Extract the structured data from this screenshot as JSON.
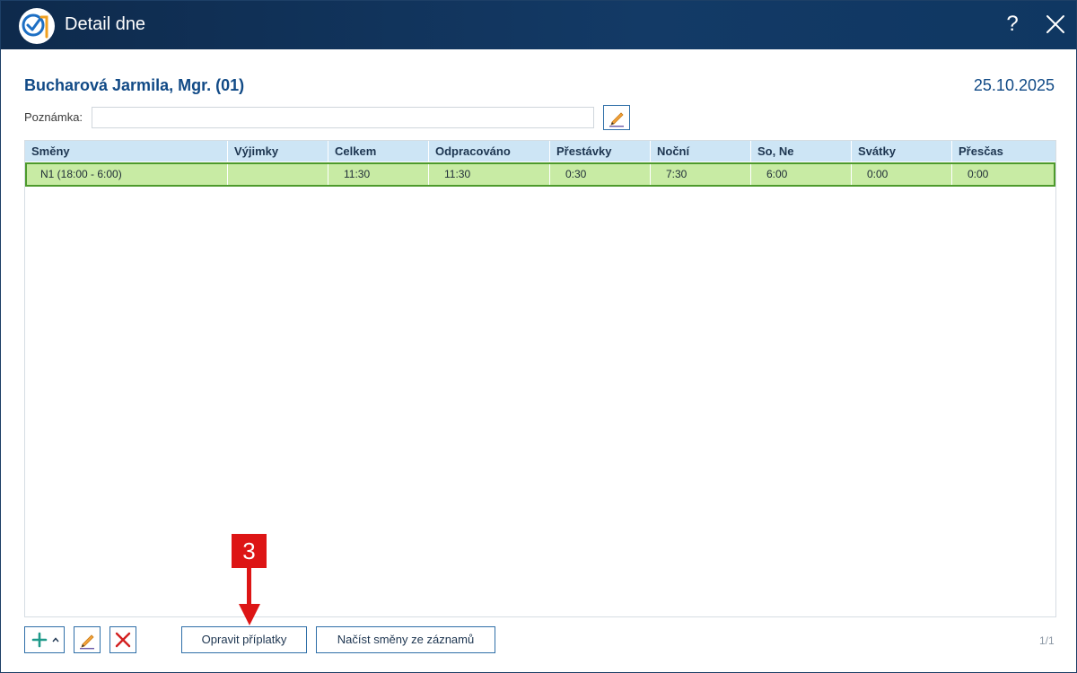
{
  "window": {
    "title": "Detail dne",
    "help": "?"
  },
  "employee": {
    "name": "Bucharová Jarmila, Mgr. (01)",
    "date": "25.10.2025"
  },
  "note": {
    "label": "Poznámka:",
    "value": ""
  },
  "table": {
    "columns": [
      "Směny",
      "Výjimky",
      "Celkem",
      "Odpracováno",
      "Přestávky",
      "Noční",
      "So, Ne",
      "Svátky",
      "Přesčas"
    ],
    "rows": [
      {
        "shift": "N1 (18:00 - 6:00)",
        "exceptions": "",
        "total": "11:30",
        "worked": "11:30",
        "breaks": "0:30",
        "night": "7:30",
        "weekend": "6:00",
        "holidays": "0:00",
        "overtime": "0:00"
      }
    ]
  },
  "toolbar": {
    "fix_surcharges": "Opravit příplatky",
    "load_shifts": "Načíst směny ze záznamů",
    "pager": "1/1"
  },
  "annotation": {
    "badge": "3"
  },
  "colors": {
    "titlebar": "#123560",
    "header_bg": "#cde5f5",
    "selected_row_bg": "#c8eba4",
    "selected_row_border": "#4d9a2c",
    "accent_blue": "#114a86",
    "delete_red": "#d21f1f",
    "add_green": "#1f9a8a",
    "callout_red": "#dd1515"
  }
}
